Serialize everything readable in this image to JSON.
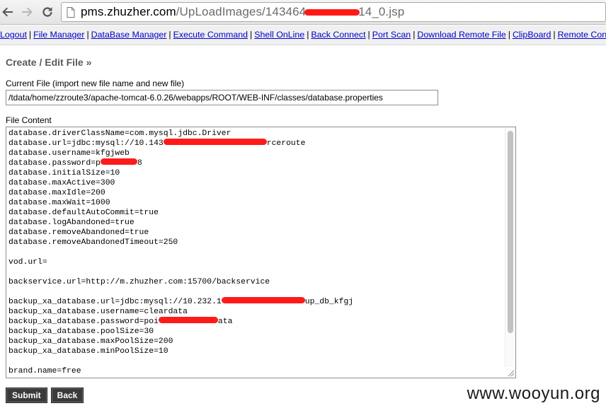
{
  "browser": {
    "url_host": "pms.zhuzher.com",
    "url_path_start": "/UpLoadImages/143464",
    "url_path_end": "14_0.jsp"
  },
  "menu": {
    "items": [
      "Logout",
      "File Manager",
      "DataBase Manager",
      "Execute Command",
      "Shell OnLine",
      "Back Connect",
      "Port Scan",
      "Download Remote File",
      "ClipBoard",
      "Remote Control"
    ],
    "separator": "|"
  },
  "page": {
    "title": "Create / Edit File »",
    "current_file_label": "Current File (import new file name and new file)",
    "current_file_value": "/tdata/home/zzroute3/apache-tomcat-6.0.26/webapps/ROOT/WEB-INF/classes/database.properties",
    "file_content_label": "File Content"
  },
  "file_content": {
    "lines": [
      [
        "database.driverClassName=com.mysql.jdbc.Driver"
      ],
      [
        "database.url=jdbc:mysql://10.143",
        "",
        "rceroute"
      ],
      [
        "database.username=kfgjweb"
      ],
      [
        "database.password=p",
        "",
        "8"
      ],
      [
        "database.initialSize=10"
      ],
      [
        "database.maxActive=300"
      ],
      [
        "database.maxIdle=200"
      ],
      [
        "database.maxWait=1000"
      ],
      [
        "database.defaultAutoCommit=true"
      ],
      [
        "database.logAbandoned=true"
      ],
      [
        "database.removeAbandoned=true"
      ],
      [
        "database.removeAbandonedTimeout=250"
      ],
      [
        ""
      ],
      [
        "vod.url="
      ],
      [
        ""
      ],
      [
        "backservice.url=http://m.zhuzher.com:15700/backservice"
      ],
      [
        ""
      ],
      [
        "backup_xa_database.url=jdbc:mysql://10.232.1",
        "",
        "up_db_kfgj"
      ],
      [
        "backup_xa_database.username=cleardata"
      ],
      [
        "backup_xa_database.password=poi",
        "",
        "ata"
      ],
      [
        "backup_xa_database.poolSize=30"
      ],
      [
        "backup_xa_database.maxPoolSize=200"
      ],
      [
        "backup_xa_database.minPoolSize=10"
      ],
      [
        ""
      ],
      [
        "brand.name=free"
      ]
    ]
  },
  "buttons": {
    "submit": "Submit",
    "back": "Back"
  },
  "watermark": "www.wooyun.org",
  "colors": {
    "link": "#0000cc",
    "redaction": "#ff1a1a",
    "button_bg": "#3a3a3a",
    "title": "#5a5a5a"
  }
}
